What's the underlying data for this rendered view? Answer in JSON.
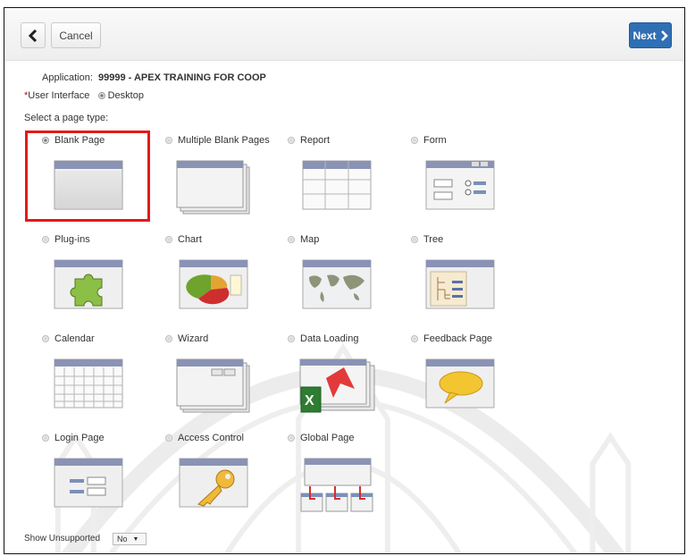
{
  "toolbar": {
    "cancel_label": "Cancel",
    "next_label": "Next"
  },
  "meta": {
    "application_label": "Application:",
    "application_value": "99999 - APEX TRAINING FOR COOP",
    "ui_label": "User Interface",
    "ui_value": "Desktop",
    "select_prompt": "Select a page type:"
  },
  "page_types": [
    {
      "label": "Blank Page",
      "selected": true
    },
    {
      "label": "Multiple Blank Pages",
      "selected": false
    },
    {
      "label": "Report",
      "selected": false
    },
    {
      "label": "Form",
      "selected": false
    },
    {
      "label": "Plug-ins",
      "selected": false
    },
    {
      "label": "Chart",
      "selected": false
    },
    {
      "label": "Map",
      "selected": false
    },
    {
      "label": "Tree",
      "selected": false
    },
    {
      "label": "Calendar",
      "selected": false
    },
    {
      "label": "Wizard",
      "selected": false
    },
    {
      "label": "Data Loading",
      "selected": false
    },
    {
      "label": "Feedback Page",
      "selected": false
    },
    {
      "label": "Login Page",
      "selected": false
    },
    {
      "label": "Access Control",
      "selected": false
    },
    {
      "label": "Global Page",
      "selected": false
    }
  ],
  "footer": {
    "show_unsupported_label": "Show Unsupported",
    "show_unsupported_value": "No"
  },
  "colors": {
    "highlight": "#e21a1a",
    "next_button": "#2f6fb4",
    "tile_header": "#8a93b5"
  }
}
